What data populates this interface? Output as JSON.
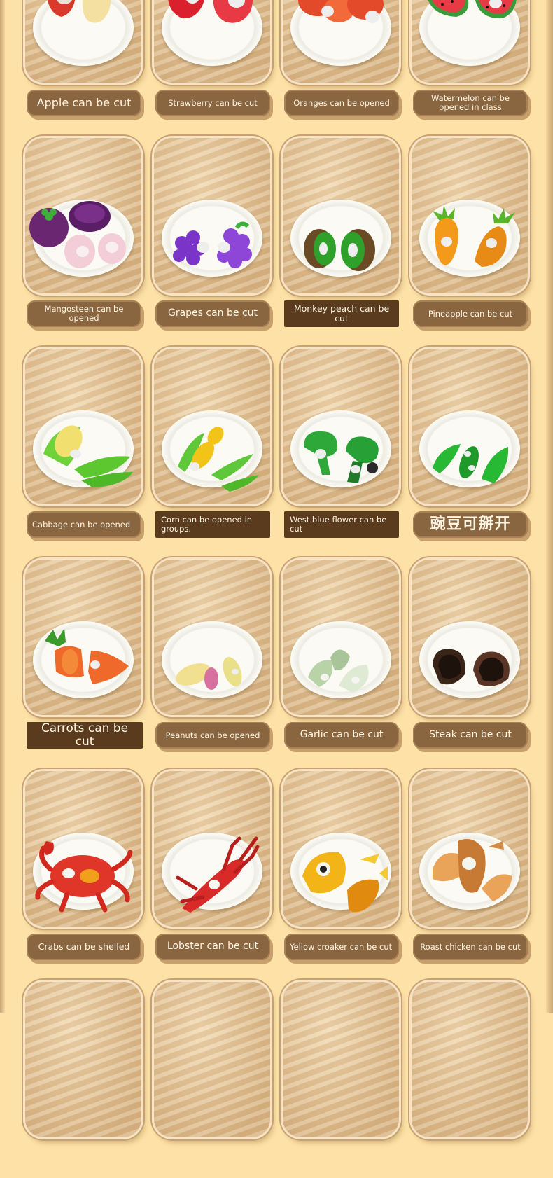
{
  "cards": [
    {
      "label": "Apple can be cut",
      "item": "apple",
      "colors": [
        "#d93a2c",
        "#f4e0a0"
      ]
    },
    {
      "label": "Strawberry can be cut",
      "item": "strawberry",
      "colors": [
        "#d9202c",
        "#e83a44"
      ]
    },
    {
      "label": "Oranges can be opened",
      "item": "orange",
      "colors": [
        "#e24a2a",
        "#f36a3a"
      ]
    },
    {
      "label": "Watermelon can be opened in class",
      "item": "watermelon",
      "colors": [
        "#3a9b3a",
        "#e83a44"
      ]
    },
    {
      "label": "Mangosteen can be opened",
      "item": "mangosteen",
      "colors": [
        "#6a2670",
        "#f3cdd8"
      ]
    },
    {
      "label": "Grapes can be cut",
      "item": "grapes",
      "colors": [
        "#7a35c8",
        "#8d46d8"
      ]
    },
    {
      "label": "Monkey peach can be cut",
      "item": "kiwi",
      "colors": [
        "#6a4a24",
        "#2fa02a"
      ]
    },
    {
      "label": "Pineapple can be cut",
      "item": "pineapple",
      "colors": [
        "#f39a1a",
        "#5ab52a"
      ]
    },
    {
      "label": "Cabbage can be opened",
      "item": "cabbage",
      "colors": [
        "#6fd23a",
        "#f1e070"
      ]
    },
    {
      "label": "Corn can be opened in groups.",
      "item": "corn",
      "colors": [
        "#f3c418",
        "#5ec83a"
      ]
    },
    {
      "label": "West blue flower can be cut",
      "item": "broccoli",
      "colors": [
        "#2fa83a",
        "#1f7a2a"
      ]
    },
    {
      "label": "豌豆可掰开",
      "item": "peas",
      "colors": [
        "#27b834",
        "#1f9a2a"
      ]
    },
    {
      "label": "Carrots can be cut",
      "item": "carrot",
      "colors": [
        "#ef6a2a",
        "#3a9b2a"
      ]
    },
    {
      "label": "Peanuts can be opened",
      "item": "peanut",
      "colors": [
        "#f1e090",
        "#d870a0"
      ]
    },
    {
      "label": "Garlic can be cut",
      "item": "garlic",
      "colors": [
        "#b9d3a8",
        "#dfead4"
      ]
    },
    {
      "label": "Steak can be cut",
      "item": "steak",
      "colors": [
        "#3a2418",
        "#5a3424"
      ]
    },
    {
      "label": "Crabs can be shelled",
      "item": "crab",
      "colors": [
        "#e0362a",
        "#f0a01a"
      ]
    },
    {
      "label": "Lobster can be cut",
      "item": "lobster",
      "colors": [
        "#d92a2a",
        "#b81e1e"
      ]
    },
    {
      "label": "Yellow croaker can be cut",
      "item": "fish",
      "colors": [
        "#f3b418",
        "#e08a10"
      ]
    },
    {
      "label": "Roast chicken can be cut",
      "item": "chicken",
      "colors": [
        "#e9a45a",
        "#c77a34"
      ]
    }
  ]
}
